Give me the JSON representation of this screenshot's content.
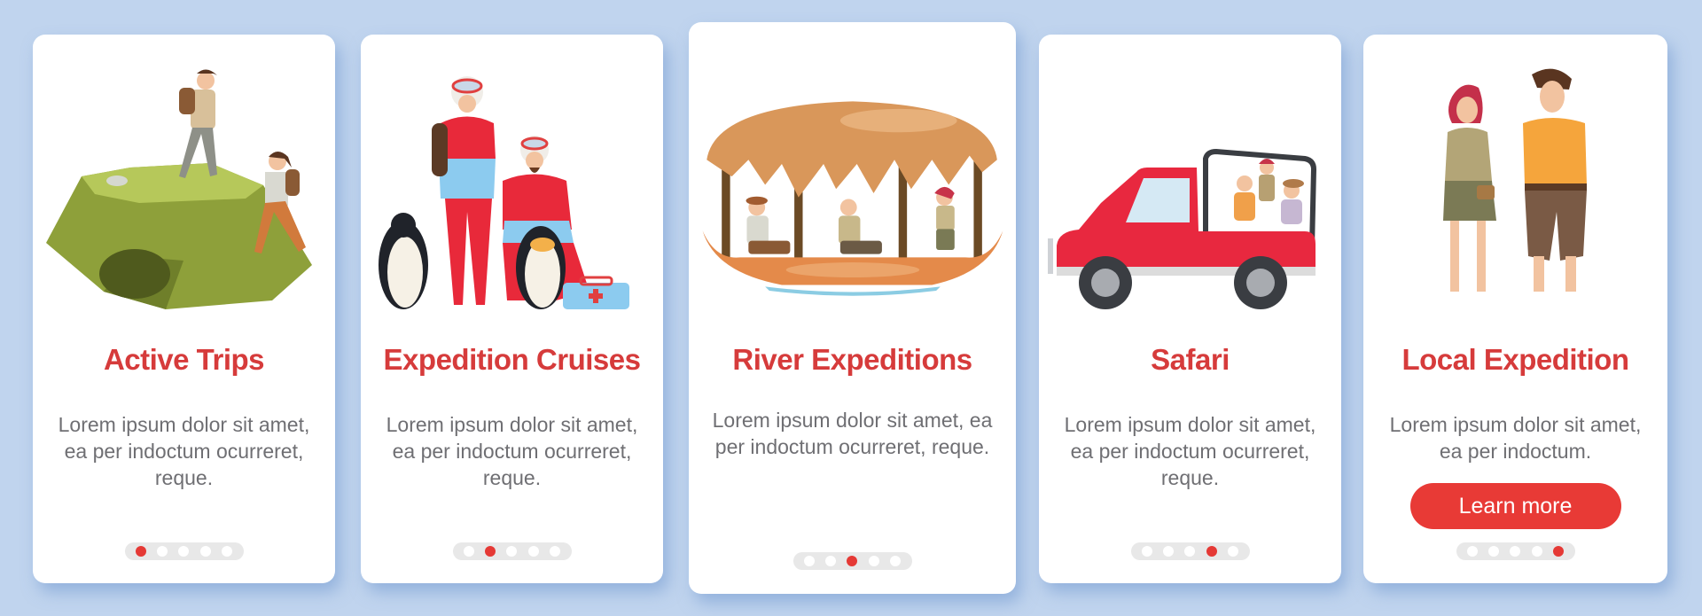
{
  "colors": {
    "background": "#c0d4ee",
    "card": "#ffffff",
    "title": "#d63b3b",
    "body_text": "#6f6f73",
    "accent": "#e53935",
    "dot_track": "#e8e8e8"
  },
  "cards": [
    {
      "illustration": "hikers-on-cliff-illustration",
      "title": "Active Trips",
      "body": "Lorem ipsum dolor sit amet, ea per indoctum ocurreret, reque.",
      "page": 1,
      "total_pages": 5
    },
    {
      "illustration": "polar-explorers-penguins-illustration",
      "title": "Expedition Cruises",
      "body": "Lorem ipsum dolor sit amet, ea per indoctum ocurreret, reque.",
      "page": 2,
      "total_pages": 5
    },
    {
      "illustration": "thatched-boat-tourists-illustration",
      "title": "River Expeditions",
      "body": "Lorem ipsum dolor sit amet, ea per indoctum ocurreret, reque.",
      "page": 3,
      "total_pages": 5
    },
    {
      "illustration": "safari-jeep-illustration",
      "title": "Safari",
      "body": "Lorem ipsum dolor sit amet, ea per indoctum ocurreret, reque.",
      "page": 4,
      "total_pages": 5
    },
    {
      "illustration": "couple-tourists-illustration",
      "title": "Local Expedition",
      "body": "Lorem ipsum dolor sit amet, ea per indoctum.",
      "page": 5,
      "total_pages": 5,
      "button_label": "Learn more"
    }
  ]
}
